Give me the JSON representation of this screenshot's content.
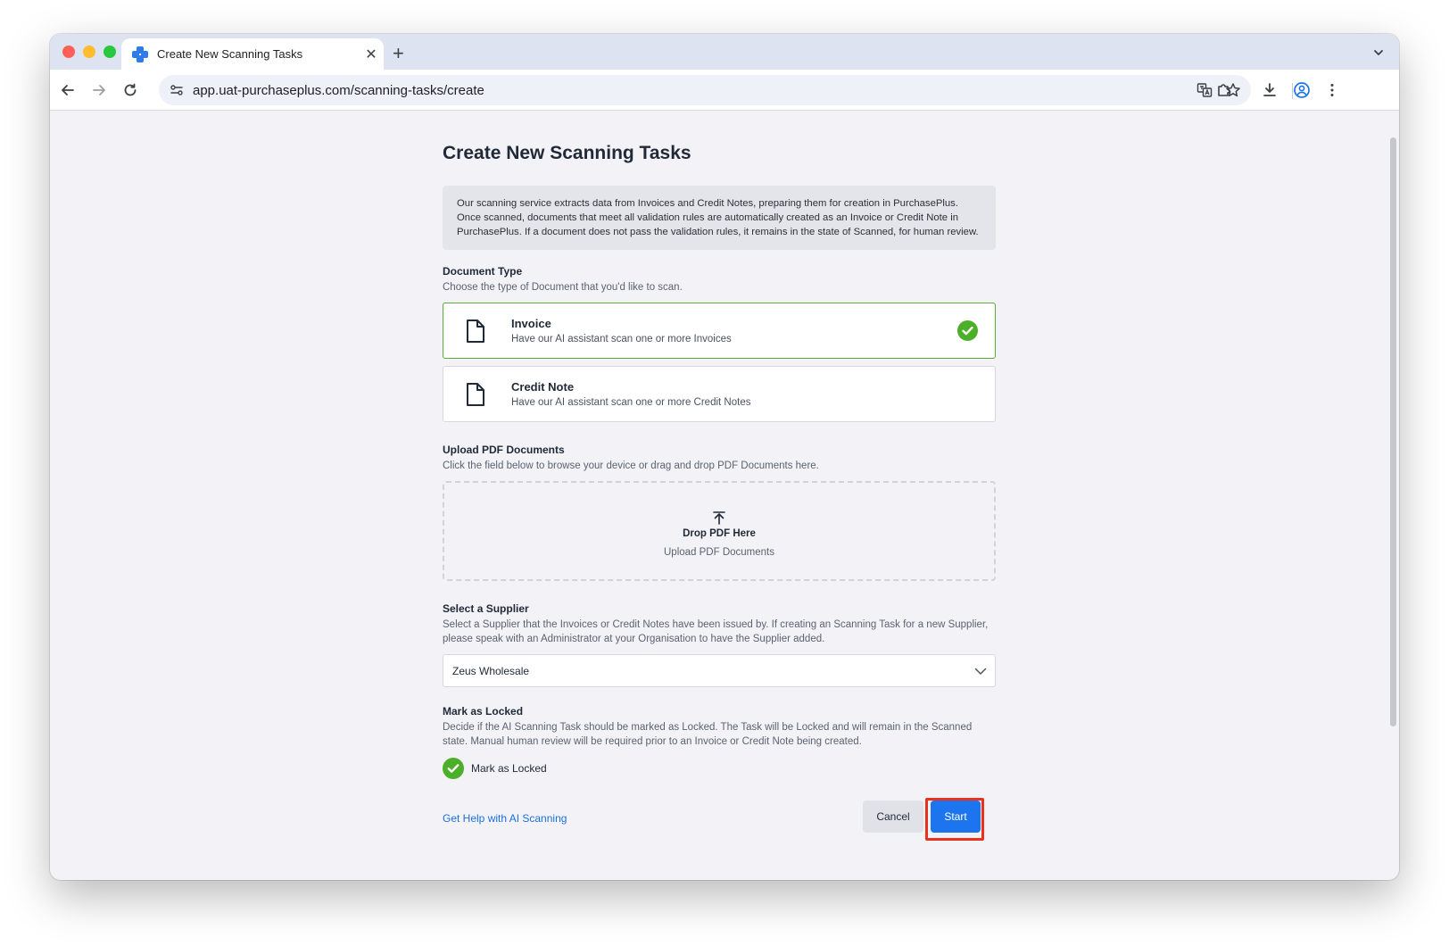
{
  "browser": {
    "tab_title": "Create New Scanning Tasks",
    "new_tab_label": "+",
    "close_tab_label": "✕",
    "url": "app.uat-purchaseplus.com/scanning-tasks/create"
  },
  "page": {
    "title": "Create New Scanning Tasks",
    "info_text": "Our scanning service extracts data from Invoices and Credit Notes, preparing them for creation in PurchasePlus. Once scanned, documents that meet all validation rules are automatically created as an Invoice or Credit Note in PurchasePlus. If a document does not pass the validation rules, it remains in the state of Scanned, for human review.",
    "document_type": {
      "title": "Document Type",
      "description": "Choose the type of Document that you'd like to scan.",
      "options": [
        {
          "title": "Invoice",
          "description": "Have our AI assistant scan one or more Invoices",
          "selected": true
        },
        {
          "title": "Credit Note",
          "description": "Have our AI assistant scan one or more Credit Notes",
          "selected": false
        }
      ]
    },
    "upload": {
      "title": "Upload PDF Documents",
      "description": "Click the field below to browse your device or drag and drop PDF Documents here.",
      "drop_title": "Drop PDF Here",
      "drop_subtitle": "Upload PDF Documents"
    },
    "supplier": {
      "title": "Select a Supplier",
      "description": "Select a Supplier that the Invoices or Credit Notes have been issued by. If creating an Scanning Task for a new Supplier, please speak with an Administrator at your Organisation to have the Supplier added.",
      "selected_value": "Zeus Wholesale"
    },
    "locked": {
      "title": "Mark as Locked",
      "description": "Decide if the AI Scanning Task should be marked as Locked. The Task will be Locked and will remain in the Scanned state. Manual human review will be required prior to an Invoice or Credit Note being created.",
      "checkbox_label": "Mark as Locked",
      "checked": true
    },
    "footer": {
      "help_link": "Get Help with AI Scanning",
      "cancel_label": "Cancel",
      "start_label": "Start"
    }
  },
  "colors": {
    "accent": "#1c74ef",
    "success": "#4caf2a",
    "highlight": "#e8321e"
  }
}
